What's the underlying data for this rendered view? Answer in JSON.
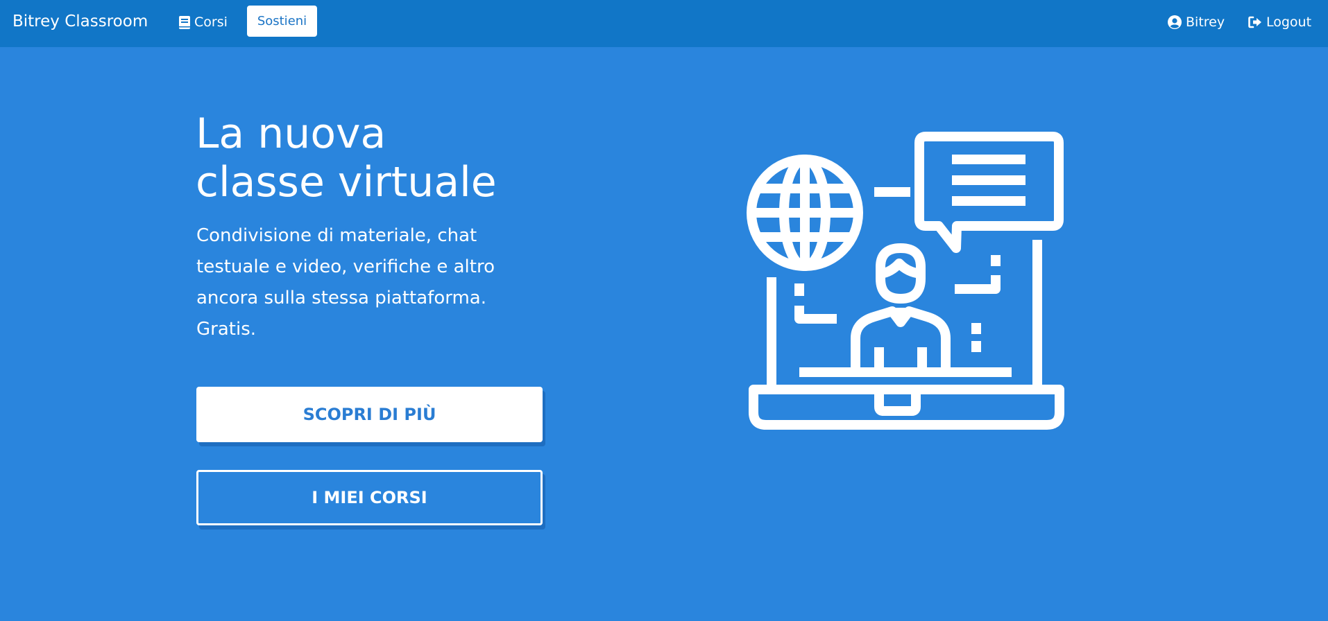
{
  "navbar": {
    "brand": "Bitrey Classroom",
    "courses_label": "Corsi",
    "support_label": "Sostieni",
    "user_label": "Bitrey",
    "logout_label": "Logout"
  },
  "hero": {
    "title_line1": "La nuova",
    "title_line2": "classe virtuale",
    "subtitle": "Condivisione di materiale, chat testuale e video, verifiche e altro ancora sulla stessa piattaforma. Gratis.",
    "primary_button": "SCOPRI DI PIÙ",
    "secondary_button": "I MIEI CORSI"
  },
  "icons": {
    "courses": "book-icon",
    "user": "user-circle-icon",
    "logout": "sign-out-icon",
    "illustration": "online-teacher-icon"
  },
  "colors": {
    "navbar": "#1176c7",
    "background": "#2a85dd",
    "accent": "#1b74c5"
  }
}
